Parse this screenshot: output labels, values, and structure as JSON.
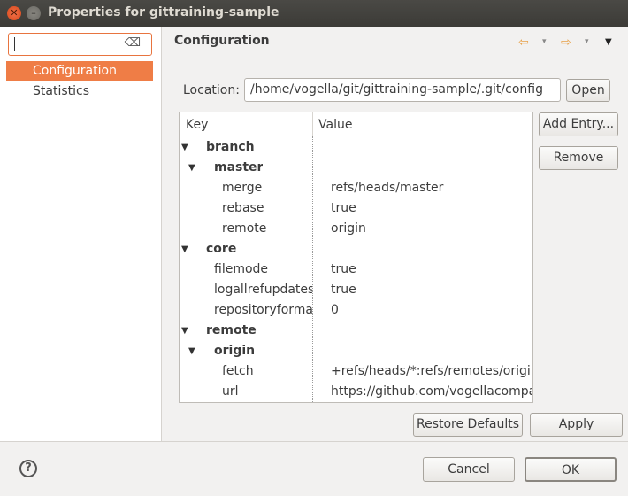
{
  "window": {
    "title": "Properties for gittraining-sample",
    "close_glyph": "✕",
    "minimize_glyph": "–"
  },
  "sidebar": {
    "filter_value": "",
    "clear_glyph": "⌫",
    "items": [
      {
        "label": "Configuration",
        "selected": true
      },
      {
        "label": "Statistics",
        "selected": false
      }
    ]
  },
  "page": {
    "title": "Configuration",
    "back_arrow": "⇦",
    "forward_arrow": "⇨",
    "dropdown_glyph": "▾",
    "menu_glyph": "▼"
  },
  "location": {
    "label": "Location:",
    "value": "/home/vogella/git/gittraining-sample/.git/config",
    "open_label": "Open"
  },
  "table": {
    "headers": {
      "key": "Key",
      "value": "Value"
    },
    "expanded_glyph": "▼",
    "rows": [
      {
        "key": "branch",
        "value": "",
        "bold": true,
        "expanded": true
      },
      {
        "key": "master",
        "value": "",
        "bold": true,
        "expanded": true
      },
      {
        "key": "merge",
        "value": "refs/heads/master"
      },
      {
        "key": "rebase",
        "value": "true"
      },
      {
        "key": "remote",
        "value": "origin"
      },
      {
        "key": "core",
        "value": "",
        "bold": true,
        "expanded": true
      },
      {
        "key": "filemode",
        "value": "true"
      },
      {
        "key": "logallrefupdates",
        "value": "true"
      },
      {
        "key": "repositoryformatversion",
        "value": "0"
      },
      {
        "key": "remote",
        "value": "",
        "bold": true,
        "expanded": true
      },
      {
        "key": "origin",
        "value": "",
        "bold": true,
        "expanded": true
      },
      {
        "key": "fetch",
        "value": "+refs/heads/*:refs/remotes/origin/*"
      },
      {
        "key": "url",
        "value": "https://github.com/vogellacompany/gittraining-sample"
      }
    ]
  },
  "side_buttons": {
    "add_entry": "Add Entry...",
    "remove": "Remove"
  },
  "bottom_buttons": {
    "restore_defaults": "Restore Defaults",
    "apply": "Apply"
  },
  "dialog_buttons": {
    "cancel": "Cancel",
    "ok": "OK"
  },
  "help": {
    "glyph": "?"
  }
}
